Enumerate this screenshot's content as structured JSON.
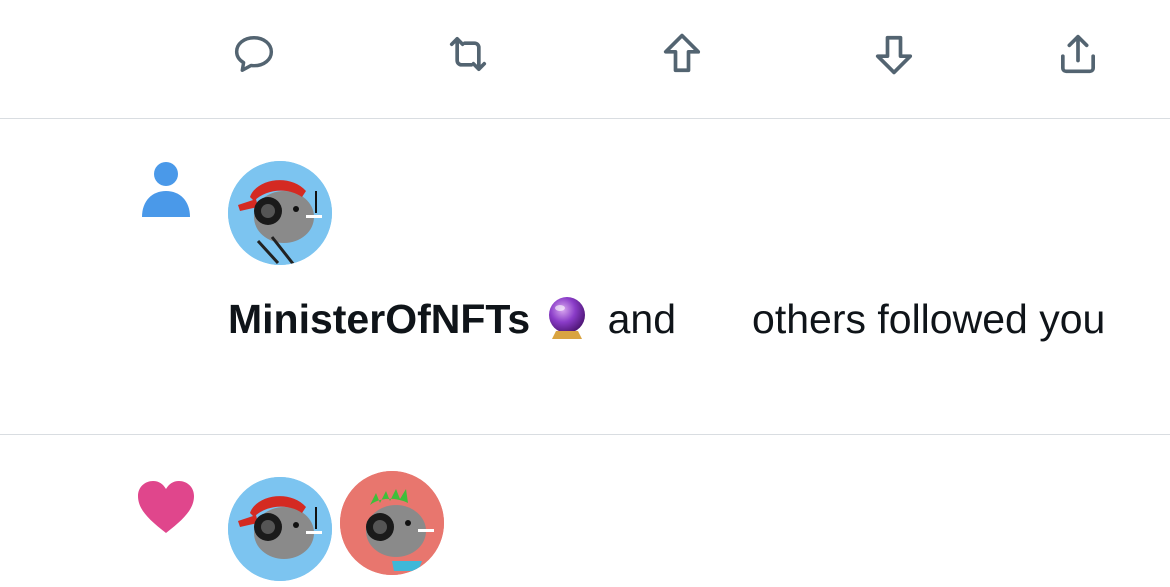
{
  "action_bar": {
    "icons": [
      "reply-icon",
      "retweet-icon",
      "upvote-icon",
      "downvote-icon",
      "share-icon"
    ],
    "icon_color": "#536471"
  },
  "follow_notification": {
    "type_icon": "person-icon",
    "type_icon_color": "#4a99e9",
    "actor_name": "MinisterOfNFTs",
    "actor_emoji": "crystal-ball-icon",
    "connector": "and",
    "rest": "others followed you"
  },
  "like_notification": {
    "type_icon": "heart-icon",
    "type_icon_color": "#e0468c"
  },
  "colors": {
    "divider": "#d9dde1",
    "avatar_blue_bg": "#7cc4f0",
    "avatar_red_bg": "#e8766e"
  }
}
